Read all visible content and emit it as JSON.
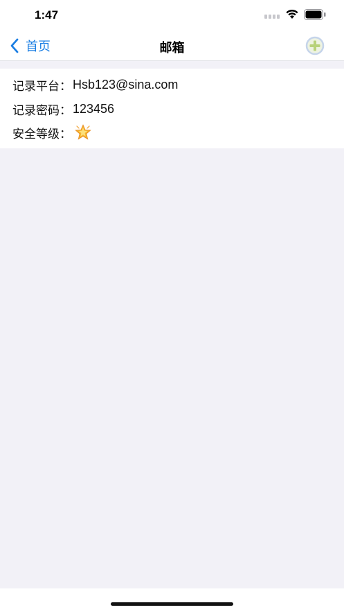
{
  "status": {
    "time": "1:47"
  },
  "nav": {
    "back_label": "首页",
    "title": "邮箱"
  },
  "record": {
    "platform_label": "记录平台：",
    "platform_value": "Hsb123@sina.com",
    "password_label": "记录密码：",
    "password_value": "123456",
    "security_label": "安全等级：",
    "security_icon": "star-icon"
  },
  "colors": {
    "accent": "#1a7ee3",
    "background": "#f2f1f7",
    "add_icon": "#b8d27a"
  }
}
